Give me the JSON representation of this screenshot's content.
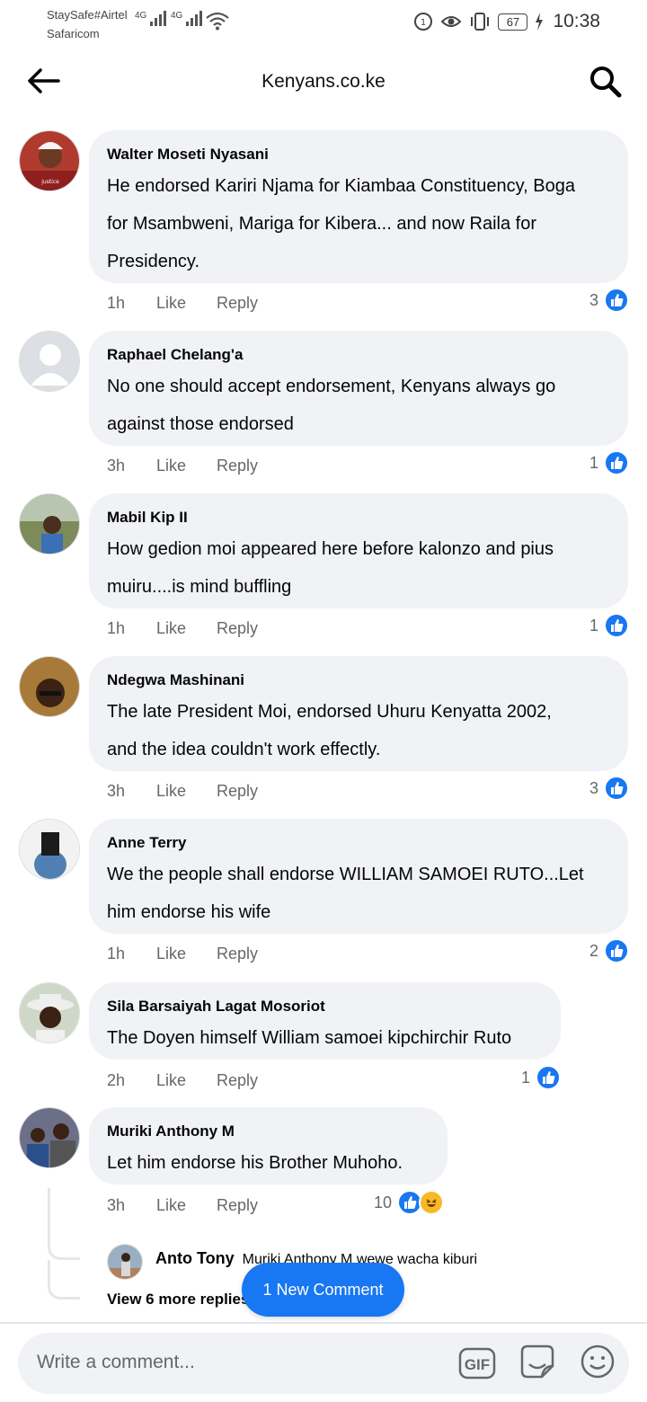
{
  "status_bar": {
    "carrier_line1": "StaySafe#Airtel",
    "carrier_line2": "Safaricom",
    "network1": "4G",
    "network2": "4G",
    "battery": "67",
    "time": "10:38"
  },
  "header": {
    "title": "Kenyans.co.ke",
    "back_icon": "back-arrow-icon",
    "search_icon": "search-icon"
  },
  "actions": {
    "like": "Like",
    "reply": "Reply"
  },
  "comments": [
    {
      "name": "Walter Moseti Nyasani",
      "lines": [
        "He endorsed Kariri Njama for Kiambaa Constituency, Boga",
        "for Msambweni, Mariga for Kibera... and now Raila for",
        "Presidency."
      ],
      "time": "1h",
      "reactions": "3"
    },
    {
      "name": "Raphael Chelang'a",
      "lines": [
        "No one should accept endorsement, Kenyans always go",
        "against those endorsed"
      ],
      "time": "3h",
      "reactions": "1"
    },
    {
      "name": "Mabil Kip II",
      "lines": [
        "How gedion moi appeared here before kalonzo and pius",
        "muiru....is mind buffling"
      ],
      "time": "1h",
      "reactions": "1"
    },
    {
      "name": "Ndegwa Mashinani",
      "lines": [
        "The late President Moi, endorsed Uhuru Kenyatta 2002,",
        "and the idea couldn't work effectly."
      ],
      "time": "3h",
      "reactions": "3"
    },
    {
      "name": "Anne Terry",
      "lines": [
        "We the people shall endorse WILLIAM SAMOEI RUTO...Let",
        "him endorse his wife"
      ],
      "time": "1h",
      "reactions": "2"
    },
    {
      "name": "Sila Barsaiyah Lagat Mosoriot",
      "lines": [
        "The Doyen himself William samoei kipchirchir Ruto"
      ],
      "time": "2h",
      "reactions": "1"
    },
    {
      "name": "Muriki Anthony M",
      "lines": [
        "Let him endorse his Brother Muhoho."
      ],
      "time": "3h",
      "reactions": "10"
    }
  ],
  "reply_preview": {
    "name": "Anto Tony",
    "text": "Muriki Anthony M wewe wacha kiburi",
    "view_more": "View 6 more replies"
  },
  "new_comment_button": "1 New Comment",
  "composer": {
    "placeholder": "Write a comment...",
    "gif_label": "GIF",
    "sticker_icon": "sticker-icon",
    "emoji_icon": "emoji-icon"
  },
  "colors": {
    "accent": "#1877f2",
    "bubble": "#f0f2f5",
    "secondary_text": "#65676b",
    "haha": "#f7b928"
  }
}
